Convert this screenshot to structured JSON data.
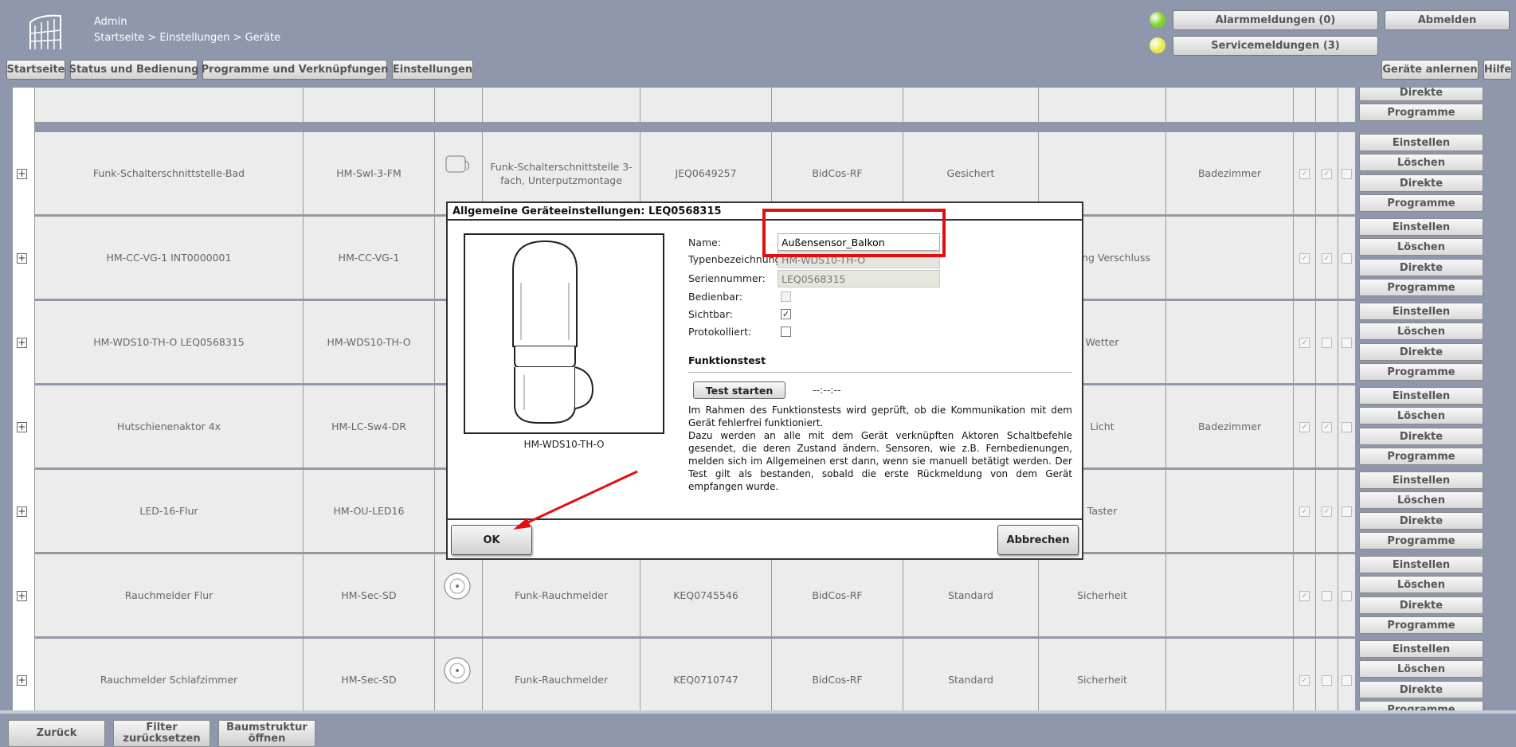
{
  "header": {
    "user": "Admin",
    "breadcrumb": "Startseite > Einstellungen > Geräte",
    "nav": [
      "Startseite",
      "Status und Bedienung",
      "Programme und Verknüpfungen",
      "Einstellungen"
    ],
    "alarm_label": "Alarmmeldungen (0)",
    "service_label": "Servicemeldungen (3)",
    "logout_label": "Abmelden",
    "learn_label": "Geräte anlernen",
    "help_label": "Hilfe",
    "alarm_led_color": "#7ed321",
    "service_led_color": "#e7e84a"
  },
  "table": {
    "actions": [
      "Einstellen",
      "Löschen",
      "Direkte",
      "Programme"
    ],
    "rows": [
      {
        "name": "Funk-Schalterschnittstelle-Bad",
        "type": "HM-SwI-3-FM",
        "description": "Funk-Schalterschnittstelle 3-fach, Unterputzmontage",
        "serial": "JEQ0649257",
        "interface": "BidCos-RF",
        "mode": "Gesichert",
        "function": "",
        "room": "Badezimmer"
      },
      {
        "name": "HM-CC-VG-1 INT0000001",
        "type": "HM-CC-VG-1",
        "description": "",
        "serial": "",
        "interface": "",
        "mode": "",
        "function": "Heizung Verschluss",
        "room": ""
      },
      {
        "name": "HM-WDS10-TH-O LEQ0568315",
        "type": "HM-WDS10-TH-O",
        "description": "",
        "serial": "",
        "interface": "",
        "mode": "",
        "function": "Wetter",
        "room": ""
      },
      {
        "name": "Hutschienenaktor 4x",
        "type": "HM-LC-Sw4-DR",
        "description": "",
        "serial": "",
        "interface": "",
        "mode": "",
        "function": "Licht",
        "room": "Badezimmer"
      },
      {
        "name": "LED-16-Flur",
        "type": "HM-OU-LED16",
        "description": "",
        "serial": "",
        "interface": "",
        "mode": "",
        "function": "Taster",
        "room": ""
      },
      {
        "name": "Rauchmelder Flur",
        "type": "HM-Sec-SD",
        "description": "Funk-Rauchmelder",
        "serial": "KEQ0745546",
        "interface": "BidCos-RF",
        "mode": "Standard",
        "function": "Sicherheit",
        "room": ""
      },
      {
        "name": "Rauchmelder Schlafzimmer",
        "type": "HM-Sec-SD",
        "description": "Funk-Rauchmelder",
        "serial": "KEQ0710747",
        "interface": "BidCos-RF",
        "mode": "Standard",
        "function": "Sicherheit",
        "room": ""
      }
    ]
  },
  "footer": {
    "back_label": "Zurück",
    "filter_label": "Filter zurücksetzen",
    "tree_label": "Baumstruktur öffnen"
  },
  "dialog": {
    "title": "Allgemeine Geräteeinstellungen: LEQ0568315",
    "image_caption": "HM-WDS10-TH-O",
    "name_label": "Name:",
    "name_value": "Außensensor_Balkon",
    "type_label": "Typenbezeichnung:",
    "type_value": "HM-WDS10-TH-O",
    "serial_label": "Seriennummer:",
    "serial_value": "LEQ0568315",
    "operable_label": "Bedienbar:",
    "visible_label": "Sichtbar:",
    "logged_label": "Protokolliert:",
    "operable_checked": false,
    "visible_checked": true,
    "logged_checked": false,
    "section_title": "Funktionstest",
    "test_button": "Test starten",
    "test_time": "--:--:--",
    "description_1": "Im Rahmen des Funktionstests wird geprüft, ob die Kommunikation mit dem Gerät fehlerfrei funktioniert.",
    "description_2": "Dazu werden an alle mit dem Gerät verknüpften Aktoren Schaltbefehle gesendet, die deren Zustand ändern. Sensoren, wie z.B. Fernbedienungen, melden sich im Allgemeinen erst dann, wenn sie manuell betätigt werden. Der Test gilt als bestanden, sobald die erste Rückmeldung von dem Gerät empfangen wurde.",
    "ok_label": "OK",
    "cancel_label": "Abbrechen"
  },
  "annotation_color": "#e01010"
}
